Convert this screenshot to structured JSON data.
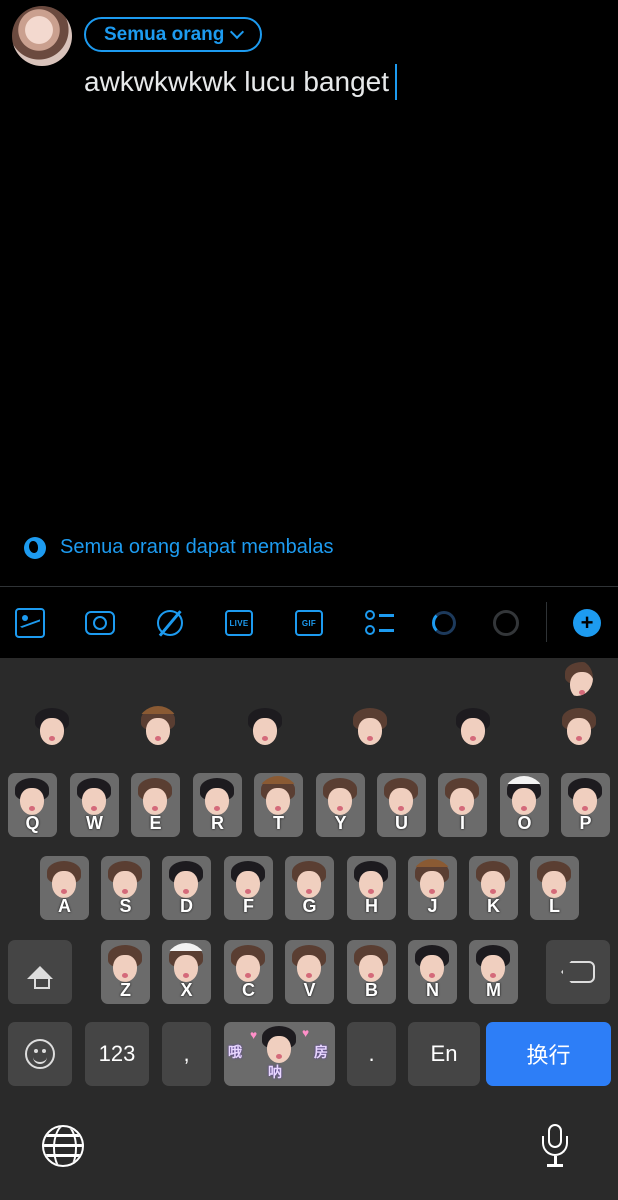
{
  "compose": {
    "audience_label": "Semua orang",
    "text": "awkwkwkwk lucu banget",
    "reply_setting": "Semua orang dapat membalas"
  },
  "toolbar": {
    "live_label": "LIVE",
    "gif_label": "GIF",
    "plus_label": "+"
  },
  "keyboard": {
    "row1": [
      "Q",
      "W",
      "E",
      "R",
      "T",
      "Y",
      "U",
      "I",
      "O",
      "P"
    ],
    "row2": [
      "A",
      "S",
      "D",
      "F",
      "G",
      "H",
      "J",
      "K",
      "L"
    ],
    "row3": [
      "Z",
      "X",
      "C",
      "V",
      "B",
      "N",
      "M"
    ],
    "numbers_label": "123",
    "comma_label": ",",
    "period_label": ".",
    "lang_label": "En",
    "enter_label": "换行",
    "space_stickers": [
      "哦",
      "呐",
      "房"
    ]
  },
  "colors": {
    "accent": "#1d9bf0",
    "enter": "#2d7ef7",
    "keyboard_bg": "#2a2a2a"
  }
}
